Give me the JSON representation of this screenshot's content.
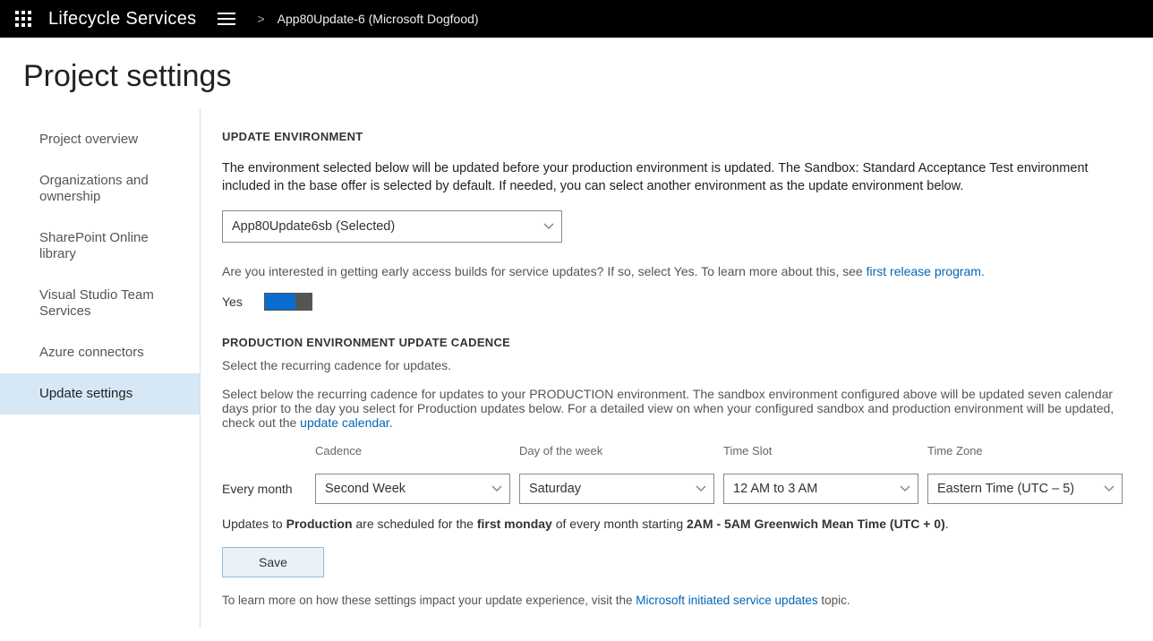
{
  "header": {
    "app_title": "Lifecycle Services",
    "breadcrumb_sep": ">",
    "project_name": "App80Update-6 (Microsoft Dogfood)"
  },
  "page_title": "Project settings",
  "sidebar": {
    "items": [
      {
        "label": "Project overview"
      },
      {
        "label": "Organizations and ownership"
      },
      {
        "label": "SharePoint Online library"
      },
      {
        "label": "Visual Studio Team Services"
      },
      {
        "label": "Azure connectors"
      },
      {
        "label": "Update settings"
      }
    ],
    "active_index": 5
  },
  "main": {
    "section1_head": "UPDATE ENVIRONMENT",
    "section1_body": "The environment selected below will be updated before your production environment is updated. The Sandbox: Standard Acceptance Test environment included in the base offer is selected by default. If needed, you can select another environment as the update environment below.",
    "env_selected": "App80Update6sb (Selected)",
    "early_access_text": "Are you interested in getting early access builds for service updates? If so, select Yes. To learn more about this, see ",
    "early_access_link": "first release program",
    "early_access_period": ".",
    "toggle_label": "Yes",
    "section2_head": "PRODUCTION ENVIRONMENT UPDATE CADENCE",
    "section2_intro": "Select the recurring cadence for updates.",
    "section2_body1": "Select below the recurring cadence for updates to your PRODUCTION environment. The sandbox environment configured above will be updated seven calendar days prior to the day you select for Production updates below. For a detailed view on when your configured sandbox and production environment will be updated, check out the ",
    "section2_link": "update calendar",
    "section2_period": ".",
    "every_month": "Every month",
    "cadence": {
      "label": "Cadence",
      "value": "Second Week"
    },
    "day": {
      "label": "Day of the week",
      "value": "Saturday"
    },
    "timeslot": {
      "label": "Time Slot",
      "value": "12 AM to 3 AM"
    },
    "timezone": {
      "label": "Time Zone",
      "value": "Eastern Time (UTC – 5)"
    },
    "summary": {
      "prefix": "Updates to ",
      "prod": "Production",
      "mid1": " are scheduled for the ",
      "when": "first monday",
      "mid2": " of every month starting ",
      "tz": "2AM - 5AM Greenwich Mean Time (UTC + 0)",
      "suffix": "."
    },
    "save_label": "Save",
    "footer_prefix": "To learn more on how these settings impact your update experience, visit the ",
    "footer_link": "Microsoft initiated service updates",
    "footer_suffix": " topic."
  }
}
